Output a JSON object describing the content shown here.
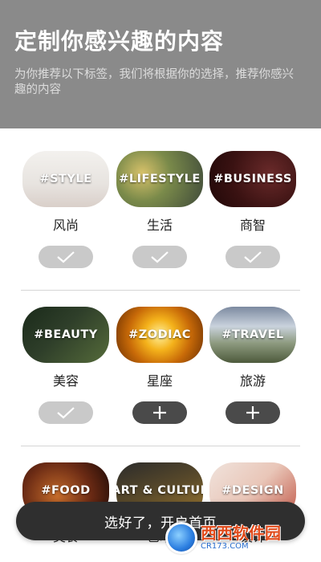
{
  "header": {
    "title": "定制你感兴趣的内容",
    "subtitle": "为你推荐以下标签，我们将根据你的选择，推荐你感兴趣的内容",
    "bg_color": "#8a8a8a"
  },
  "topics": [
    {
      "tag": "#STYLE",
      "name": "风尚",
      "selected": true,
      "toggle_icon": "check-icon"
    },
    {
      "tag": "#LIFESTYLE",
      "name": "生活",
      "selected": true,
      "toggle_icon": "check-icon"
    },
    {
      "tag": "#BUSINESS",
      "name": "商智",
      "selected": true,
      "toggle_icon": "check-icon"
    },
    {
      "tag": "#BEAUTY",
      "name": "美容",
      "selected": true,
      "toggle_icon": "check-icon"
    },
    {
      "tag": "#ZODIAC",
      "name": "星座",
      "selected": false,
      "toggle_icon": "plus-icon"
    },
    {
      "tag": "#TRAVEL",
      "name": "旅游",
      "selected": false,
      "toggle_icon": "plus-icon"
    },
    {
      "tag": "#FOOD",
      "name": "美食",
      "selected": false,
      "toggle_icon": "plus-icon"
    },
    {
      "tag": "#ART & CULTURE",
      "name": "艺术",
      "selected": false,
      "toggle_icon": "plus-icon"
    },
    {
      "tag": "#DESIGN",
      "name": "设计",
      "selected": false,
      "toggle_icon": "plus-icon"
    }
  ],
  "cta": {
    "label": "选好了，开启首页",
    "bg_color": "#2f2f2f"
  },
  "colors": {
    "toggle_on": "#c9c9c9",
    "toggle_off": "#4a4a4a"
  },
  "watermark": {
    "main": "西西软件园",
    "sub": "CR173.COM"
  }
}
